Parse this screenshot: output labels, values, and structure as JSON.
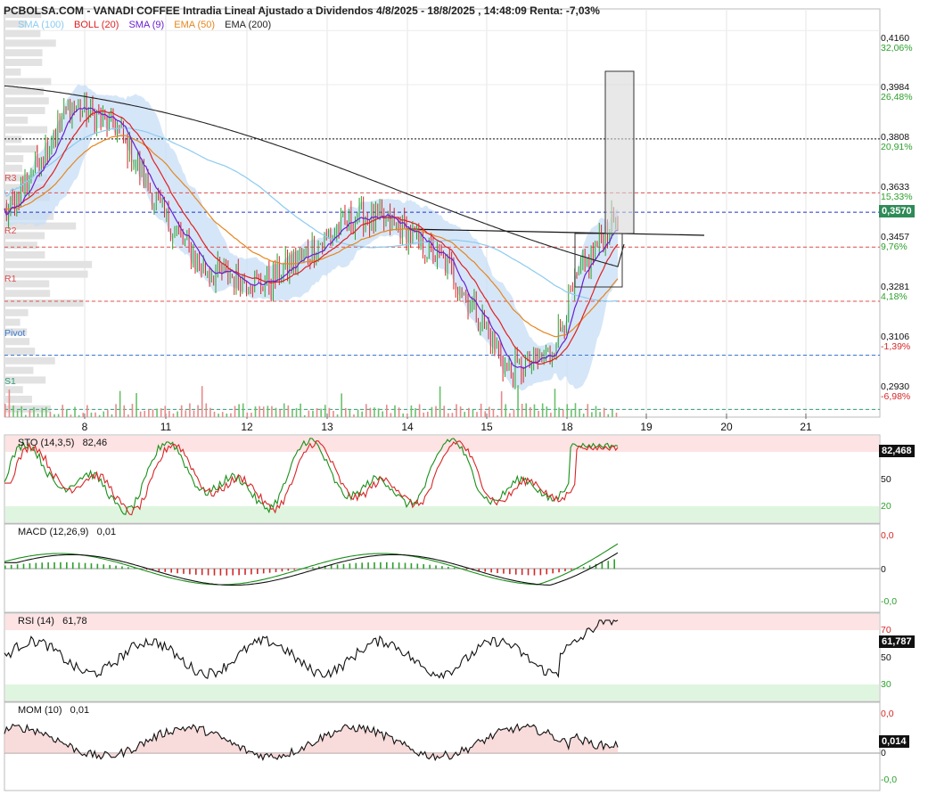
{
  "title": "PCBOLSA.COM - VANADI COFFEE Intradia Lineal Ajustado a Dividendos 4/8/2025 - 18/8/2025 , 14:48:09 Renta: -7,03%",
  "legend": [
    {
      "label": "SMA (100)",
      "color": "#8ccbf0"
    },
    {
      "label": "BOLL (20)",
      "color": "#e02020"
    },
    {
      "label": "SMA (9)",
      "color": "#6a1fd1"
    },
    {
      "label": "EMA (50)",
      "color": "#e6861e"
    },
    {
      "label": "EMA (200)",
      "color": "#222222"
    }
  ],
  "colors": {
    "up": "#2ca02c",
    "down": "#d62728",
    "boll_fill": "#c7ddf6",
    "grid": "#e6e6e6"
  },
  "price_axis": [
    {
      "price": "0,4160",
      "pct": "32,06%",
      "pct_color": "#2ca02c"
    },
    {
      "price": "0,3984",
      "pct": "26,48%",
      "pct_color": "#2ca02c"
    },
    {
      "price": "0,3808",
      "pct": "20,91%",
      "pct_color": "#2ca02c"
    },
    {
      "price": "0,3633",
      "pct": "15,33%",
      "pct_color": "#2ca02c"
    },
    {
      "price": "0,3457",
      "pct": "9,76%",
      "pct_color": "#2ca02c"
    },
    {
      "price": "0,3281",
      "pct": "4,18%",
      "pct_color": "#2ca02c"
    },
    {
      "price": "0,3106",
      "pct": "-1,39%",
      "pct_color": "#d62728"
    },
    {
      "price": "0,2930",
      "pct": "-6,98%",
      "pct_color": "#d62728"
    }
  ],
  "last_price": "0,3570",
  "pivots": [
    {
      "label": "R2",
      "price": 0.3457,
      "color": "#e05050"
    },
    {
      "label": "R1",
      "price": 0.3281,
      "color": "#e05050"
    },
    {
      "label": "Pivot",
      "price": 0.3106,
      "color": "#3a78d0"
    },
    {
      "label": "S1",
      "price": 0.293,
      "color": "#2e9e78"
    }
  ],
  "x_labels": [
    "8",
    "11",
    "12",
    "13",
    "14",
    "15",
    "18",
    "19",
    "20",
    "21"
  ],
  "panels": {
    "sto": {
      "label": "STO (14,3,5)",
      "value": "82,46",
      "badge": "82,468",
      "levels": [
        "50",
        "20"
      ]
    },
    "macd": {
      "label": "MACD (12,26,9)",
      "value": "0,01",
      "levels": [
        "0,0",
        "0",
        "-0,0"
      ]
    },
    "rsi": {
      "label": "RSI (14)",
      "value": "61,78",
      "badge": "61,787",
      "levels": [
        "70",
        "50",
        "30"
      ]
    },
    "mom": {
      "label": "MOM (10)",
      "value": "0,01",
      "badge": "0,014",
      "levels": [
        "0,0",
        "0",
        "-0,0"
      ]
    }
  },
  "chart_data": {
    "type": "line",
    "title": "PCBOLSA.COM - VANADI COFFEE Intradia Lineal Ajustado a Dividendos 4/8/2025 - 18/8/2025 , 14:48:09 Renta: -7,03%",
    "x_ticks": [
      "8",
      "11",
      "12",
      "13",
      "14",
      "15",
      "18",
      "19",
      "20",
      "21"
    ],
    "ylim": [
      0.2905,
      0.423
    ],
    "y_ticks": [
      0.416,
      0.3984,
      0.3808,
      0.3633,
      0.3457,
      0.3281,
      0.3106,
      0.293
    ],
    "price_anchors": {
      "x": [
        "8",
        "8",
        "11",
        "11",
        "12",
        "12",
        "13",
        "13",
        "14",
        "14",
        "15",
        "15",
        "18",
        "18",
        "18"
      ],
      "close": [
        0.355,
        0.392,
        0.385,
        0.355,
        0.338,
        0.334,
        0.345,
        0.356,
        0.352,
        0.34,
        0.322,
        0.305,
        0.31,
        0.336,
        0.357
      ]
    },
    "series": [
      {
        "name": "SMA (100)"
      },
      {
        "name": "BOLL (20)"
      },
      {
        "name": "SMA (9)"
      },
      {
        "name": "EMA (50)"
      },
      {
        "name": "EMA (200)"
      }
    ],
    "indicators": {
      "STO (14,3,5)": 82.46,
      "MACD (12,26,9)": 0.01,
      "RSI (14)": 61.78,
      "MOM (10)": 0.01
    }
  }
}
